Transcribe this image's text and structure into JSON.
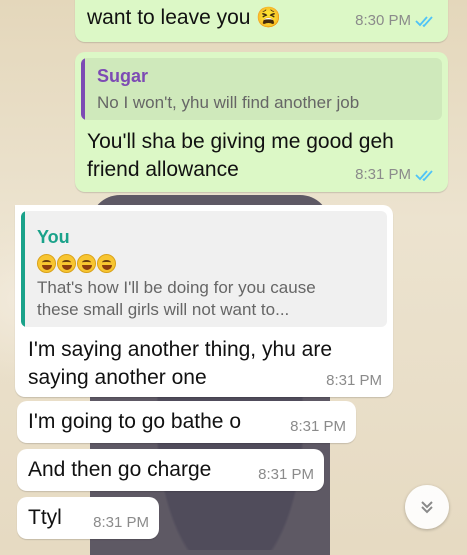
{
  "messages": [
    {
      "text": "want to leave you",
      "emoji": "😫",
      "time": "8:30 PM",
      "direction": "outgoing",
      "status": "read"
    },
    {
      "quote_name": "Sugar",
      "quote_text": "No I won't, yhu will find another job",
      "text_lines": [
        "You'll sha be giving me good geh",
        "friend allowance"
      ],
      "time": "8:31 PM",
      "direction": "outgoing",
      "status": "read"
    },
    {
      "quote_name": "You",
      "quote_emojis": "😂😂😂😂",
      "quote_text_lines": [
        "That's how I'll be doing for you cause",
        "these small girls will not want to..."
      ],
      "text_lines": [
        "I'm saying another thing, yhu are",
        "saying another one"
      ],
      "time": "8:31 PM",
      "direction": "incoming"
    },
    {
      "text": "I'm going to go bathe o",
      "time": "8:31 PM",
      "direction": "incoming"
    },
    {
      "text": "And then go charge",
      "time": "8:31 PM",
      "direction": "incoming"
    },
    {
      "text": "Ttyl",
      "time": "8:31 PM",
      "direction": "incoming"
    }
  ],
  "colors": {
    "outgoing_bubble": "#dcf8c6",
    "incoming_bubble": "#ffffff",
    "read_ticks": "#4fc3f7",
    "quote_sugar": "#7d4bb4",
    "quote_you": "#1aa28a"
  },
  "scroll_button_icon": "chevron-double-down-icon"
}
